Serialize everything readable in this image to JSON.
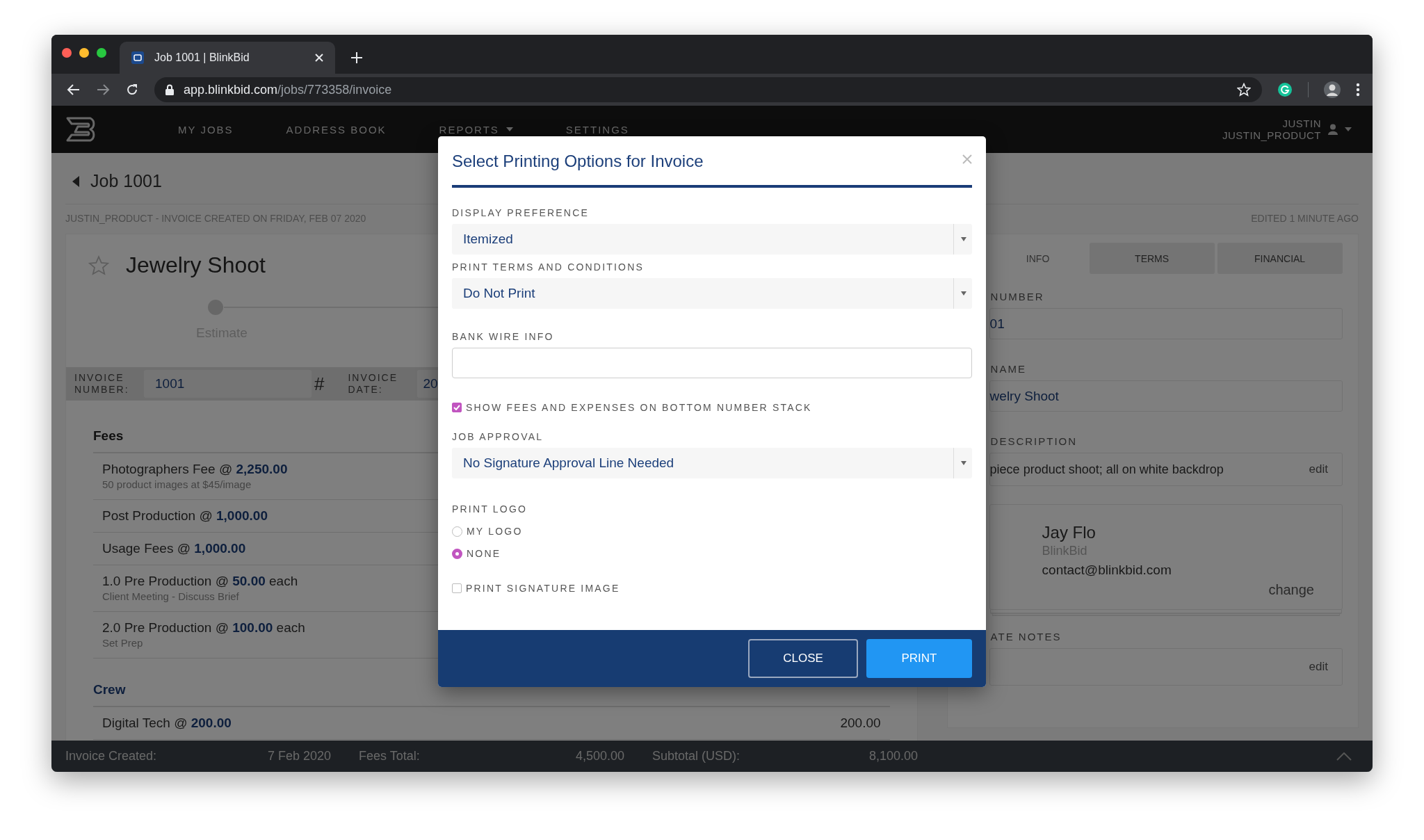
{
  "browser": {
    "tab_title": "Job 1001 | BlinkBid",
    "url_host": "app.blinkbid.com",
    "url_path": "/jobs/773358/invoice"
  },
  "nav": {
    "items": [
      {
        "label": "MY JOBS",
        "dropdown": false
      },
      {
        "label": "ADDRESS BOOK",
        "dropdown": false
      },
      {
        "label": "REPORTS",
        "dropdown": true
      },
      {
        "label": "SETTINGS",
        "dropdown": false
      }
    ],
    "user": {
      "name": "JUSTIN",
      "account": "JUSTIN_PRODUCT"
    }
  },
  "job": {
    "back_title": "Job 1001",
    "meta": "JUSTIN_PRODUCT - INVOICE CREATED ON FRIDAY, FEB 07 2020",
    "edited": "EDITED 1 MINUTE AGO",
    "title": "Jewelry Shoot",
    "starred": false,
    "stage": "Estimate"
  },
  "invoice": {
    "number_label": "INVOICE NUMBER:",
    "number_value": "1001",
    "hash": "#",
    "date_label": "INVOICE DATE:",
    "date_value": "20"
  },
  "sections": [
    {
      "title": "Fees",
      "color": "#222222",
      "items": [
        {
          "text": "Photographers Fee @ **2,250.00**",
          "note": "50 product images at $45/image"
        },
        {
          "text": "Post Production @ **1,000.00**"
        },
        {
          "text": "Usage Fees @ **1,000.00**"
        },
        {
          "text": "1.0 Pre Production @ **50.00** each",
          "note": "Client Meeting - Discuss Brief"
        },
        {
          "text": "2.0 Pre Production @ **100.00** each",
          "note": "Set Prep"
        }
      ]
    },
    {
      "title": "Crew",
      "color": "#1c3f7a",
      "items": [
        {
          "text": "Digital Tech @ **200.00**",
          "amount": "200.00"
        }
      ]
    }
  ],
  "right_panel": {
    "tabs": [
      {
        "label": "INFO",
        "selected": true
      },
      {
        "label": "TERMS",
        "selected": false
      },
      {
        "label": "FINANCIAL",
        "selected": false
      }
    ],
    "fields": [
      {
        "label": "NUMBER",
        "value": "01"
      },
      {
        "label": "NAME",
        "value": "welry Shoot"
      },
      {
        "label": "DESCRIPTION",
        "value": "piece product shoot; all on white backdrop",
        "action": "edit"
      }
    ],
    "contact": {
      "name": "Jay Flo",
      "company": "BlinkBid",
      "email": "contact@blinkbid.com",
      "action": "change"
    },
    "notes": {
      "label": "ATE NOTES",
      "action": "edit"
    }
  },
  "footer": [
    {
      "label": "Invoice Created:",
      "value": "7 Feb 2020"
    },
    {
      "label": "Fees Total:",
      "value": "4,500.00"
    },
    {
      "label": "Subtotal (USD):",
      "value": "8,100.00"
    }
  ],
  "dialog": {
    "title": "Select Printing Options for Invoice",
    "fields": [
      {
        "kind": "select",
        "label": "DISPLAY PREFERENCE",
        "value": "Itemized"
      },
      {
        "kind": "select",
        "label": "PRINT TERMS AND CONDITIONS",
        "value": "Do Not Print"
      },
      {
        "kind": "text",
        "label": "BANK WIRE INFO"
      },
      {
        "kind": "checkbox",
        "label": "SHOW FEES AND EXPENSES ON BOTTOM NUMBER STACK",
        "checked": true
      },
      {
        "kind": "select",
        "label": "JOB APPROVAL",
        "value": "No Signature Approval Line Needed"
      },
      {
        "kind": "radio",
        "label": "PRINT LOGO",
        "options": [
          {
            "label": "MY LOGO",
            "selected": false
          },
          {
            "label": "NONE",
            "selected": true
          }
        ]
      },
      {
        "kind": "checkbox",
        "label": "PRINT SIGNATURE IMAGE",
        "checked": false
      }
    ],
    "buttons": [
      {
        "label": "CLOSE",
        "kind": "secondary"
      },
      {
        "label": "PRINT",
        "kind": "primary"
      }
    ]
  }
}
